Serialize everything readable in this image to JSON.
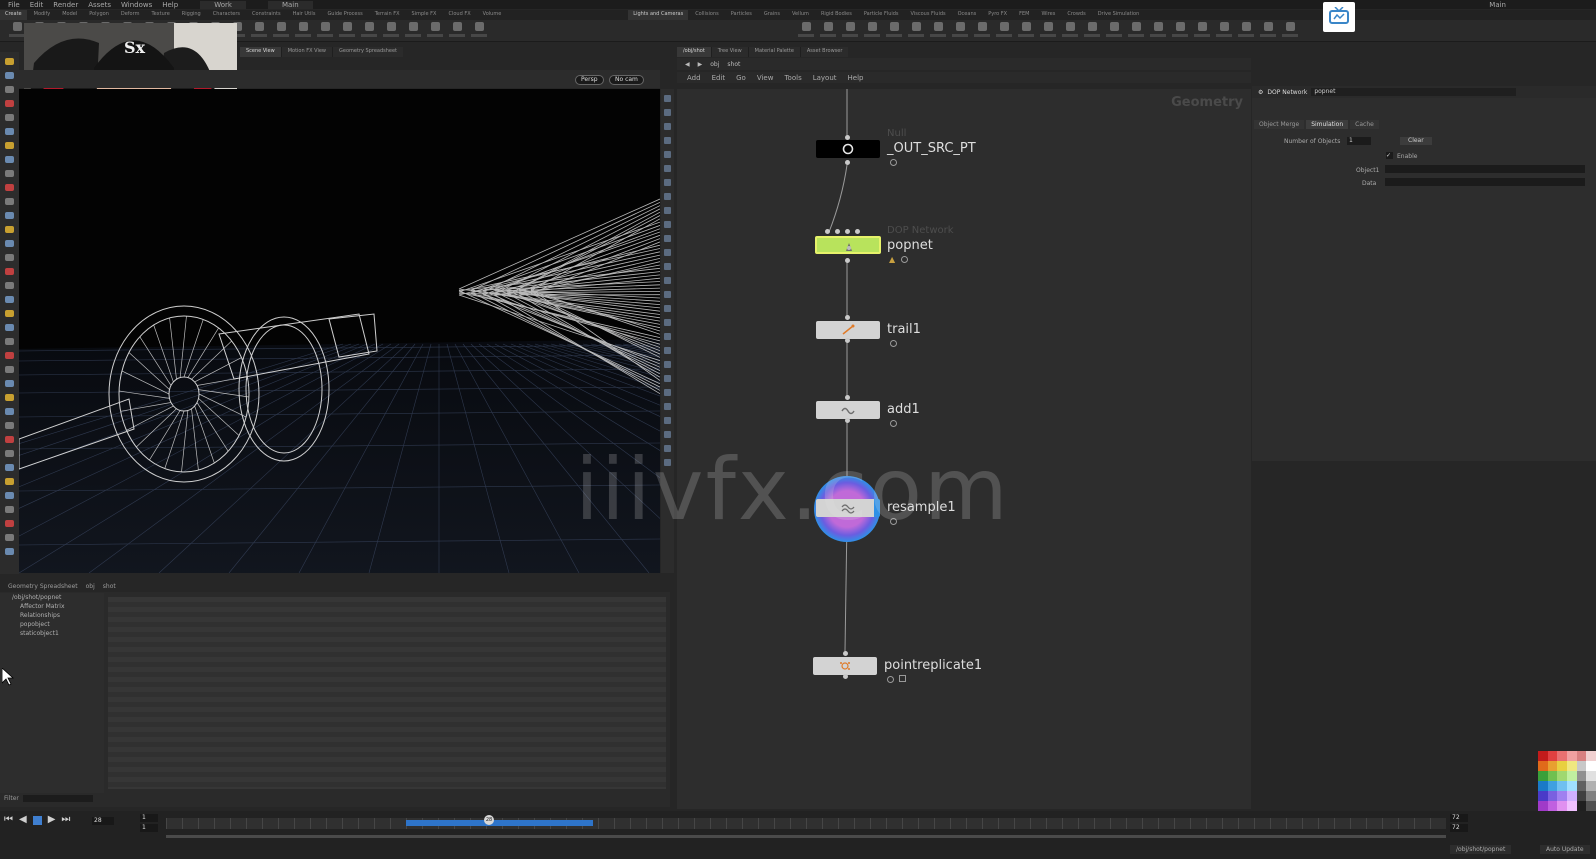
{
  "menubar": {
    "items": [
      "File",
      "Edit",
      "Render",
      "Assets",
      "Windows",
      "Help"
    ],
    "desktop": "Work",
    "desktop2": "Main",
    "right": "Main"
  },
  "shelf_tabs": [
    "Create",
    "Modify",
    "Model",
    "Polygon",
    "Deform",
    "Texture",
    "Rigging",
    "Characters",
    "Constraints",
    "Hair Utils",
    "Guide Process",
    "Terrain FX",
    "Simple FX",
    "Cloud FX",
    "Volume",
    "Lights and Cameras",
    "Collisions",
    "Particles",
    "Grains",
    "Vellum",
    "Rigid Bodies",
    "Particle Fluids",
    "Viscous Fluids",
    "Oceans",
    "Pyro FX",
    "FEM",
    "Wires",
    "Crowds",
    "Drive Simulation"
  ],
  "left_pane": {
    "tabs": [
      "Scene View",
      "Motion FX View",
      "Geometry Spreadsheet"
    ],
    "view_mode": "Persp",
    "camera": "No cam"
  },
  "spreadsheet": {
    "tab": "Geometry Spreadsheet",
    "path_root": "obj",
    "path_node": "shot",
    "tree": [
      "/obj/shot/popnet",
      "Affector Matrix",
      "Relationships",
      "popobject",
      "staticobject1"
    ],
    "filter_label": "Filter"
  },
  "network": {
    "tabs": [
      "/obj/shot",
      "Tree View",
      "Material Palette",
      "Asset Browser"
    ],
    "path_root": "obj",
    "path_node": "shot",
    "menu": [
      "Add",
      "Edit",
      "Go",
      "View",
      "Tools",
      "Layout",
      "Help"
    ],
    "context_label": "Geometry",
    "nodes": [
      {
        "type": "Null",
        "name": "_OUT_SRC_PT"
      },
      {
        "type": "DOP Network",
        "name": "popnet"
      },
      {
        "type": "",
        "name": "trail1"
      },
      {
        "type": "",
        "name": "add1"
      },
      {
        "type": "",
        "name": "resample1"
      },
      {
        "type": "",
        "name": "pointreplicate1"
      }
    ]
  },
  "params": {
    "node_type": "DOP Network",
    "node_name": "popnet",
    "tabs": [
      "Object Merge",
      "Simulation",
      "Cache"
    ],
    "active_tab": "Simulation",
    "num_objects_label": "Number of Objects",
    "num_objects_value": "1",
    "clear_label": "Clear",
    "enable_label": "Enable",
    "object_label": "Object1",
    "data_label": "Data"
  },
  "timeline": {
    "current_frame": "28",
    "start_frame": "1",
    "start_frame2": "1",
    "end_frame": "72",
    "end_frame2": "72",
    "marker": "28"
  },
  "status": {
    "path": "/obj/shot/popnet",
    "update": "Auto Update"
  },
  "watermark": "iiivfx.com",
  "colors": {
    "dop_node": "#b8e35c",
    "cache_bar": "#2e74c9",
    "selected_node": "#2f90e6"
  }
}
